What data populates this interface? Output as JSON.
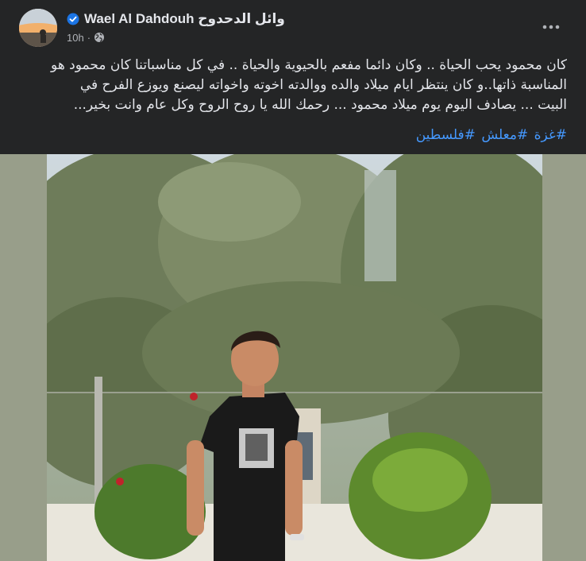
{
  "author": {
    "name": "Wael Al Dahdouh وائل الدحدوح",
    "verified": true
  },
  "meta": {
    "time": "10h",
    "separator": "·",
    "privacy_icon": "globe-icon"
  },
  "menu": {
    "more_icon": "more-horizontal-icon"
  },
  "post": {
    "text_lines": [
      "كان محمود يحب الحياة .. وكان دائما مفعم بالحيوية والحياة .. في كل مناسباتنا كان محمود هو",
      "المناسبة ذاتها..و كان ينتظر ايام ميلاد والده ووالدته اخوته واخواته ليصنع ويوزع الفرح في",
      "البيت ... يصادف اليوم يوم ميلاد محمود ... رحمك الله يا روح الروح وكل عام وانت بخير..."
    ],
    "hashtags": [
      "#غزة",
      "#معلش",
      "#فلسطين"
    ]
  },
  "colors": {
    "background": "#242526",
    "text": "#e4e6eb",
    "secondary_text": "#b0b3b8",
    "link": "#4599ff",
    "verified_badge": "#1b74e4",
    "photo_matte": "#989e8a"
  }
}
